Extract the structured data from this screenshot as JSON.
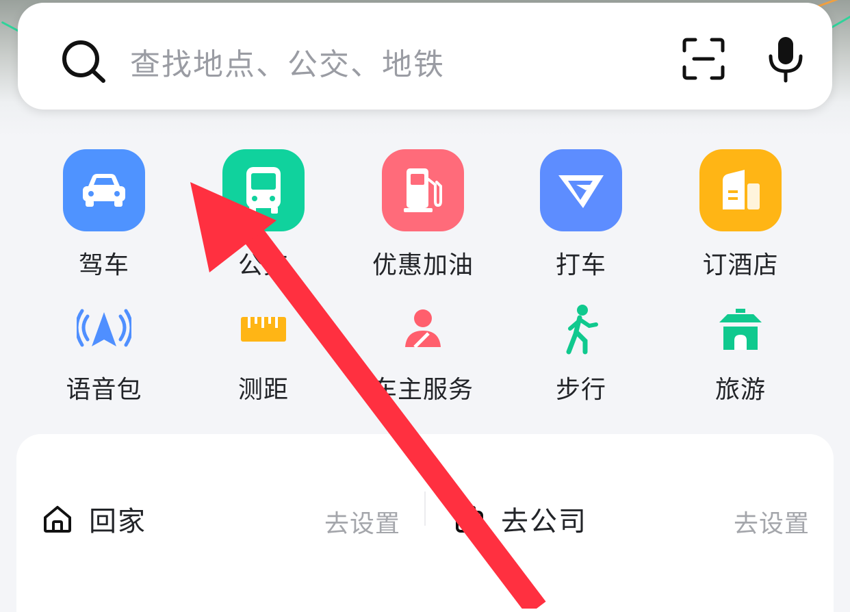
{
  "search": {
    "placeholder": "查找地点、公交、地铁"
  },
  "tools_row1": [
    {
      "label": "驾车",
      "icon": "car-icon",
      "color": "#4f93ff"
    },
    {
      "label": "公交",
      "icon": "bus-icon",
      "color": "#10d29d"
    },
    {
      "label": "优惠加油",
      "icon": "fuel-pump-icon",
      "color": "#ff6b7a"
    },
    {
      "label": "打车",
      "icon": "taxi-logo-icon",
      "color": "#5d8dff"
    },
    {
      "label": "订酒店",
      "icon": "hotel-icon",
      "color": "#ffb515"
    }
  ],
  "tools_row2": [
    {
      "label": "语音包",
      "icon": "voice-navigation-icon",
      "color": "#4f8fff"
    },
    {
      "label": "测距",
      "icon": "ruler-icon",
      "color": "#ffb515"
    },
    {
      "label": "车主服务",
      "icon": "driver-service-icon",
      "color": "#ff5f6d"
    },
    {
      "label": "步行",
      "icon": "walking-icon",
      "color": "#10c98e"
    },
    {
      "label": "旅游",
      "icon": "pavilion-icon",
      "color": "#10c98e"
    }
  ],
  "favorites": {
    "home": {
      "label": "回家",
      "action": "去设置"
    },
    "work": {
      "label": "去公司",
      "action": "去设置"
    }
  },
  "colors": {
    "annotation_arrow": "#ff3040"
  }
}
